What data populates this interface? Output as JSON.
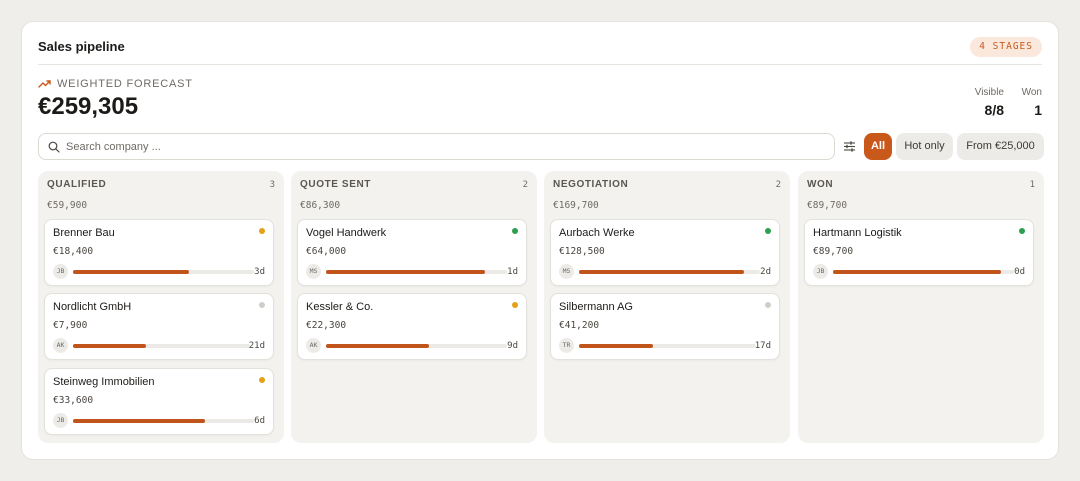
{
  "header": {
    "title": "Sales pipeline",
    "stages_badge": "4 STAGES"
  },
  "forecast": {
    "label": "WEIGHTED FORECAST",
    "value": "€259,305",
    "icon": "trend-up-icon"
  },
  "stats": {
    "visible_label": "Visible",
    "visible_value": "8/8",
    "won_label": "Won",
    "won_value": "1"
  },
  "search": {
    "placeholder": "Search company ...",
    "value": ""
  },
  "filters": [
    {
      "label": "All",
      "active": true
    },
    {
      "label": "Hot only",
      "active": false
    },
    {
      "label": "From €25,000",
      "active": false
    }
  ],
  "colors": {
    "accent": "#c9591b",
    "hot": "#e3a118",
    "active": "#2e9e4f",
    "idle": "#cfcdc8"
  },
  "columns": [
    {
      "name": "QUALIFIED",
      "count": "3",
      "total": "€59,900",
      "cards": [
        {
          "name": "Brenner Bau",
          "value": "€18,400",
          "owner": "JB",
          "progress": 0.64,
          "days": "3d",
          "status": "hot"
        },
        {
          "name": "Nordlicht GmbH",
          "value": "€7,900",
          "owner": "AK",
          "progress": 0.41,
          "days": "21d",
          "status": "idle"
        },
        {
          "name": "Steinweg Immobilien",
          "value": "€33,600",
          "owner": "JB",
          "progress": 0.73,
          "days": "6d",
          "status": "hot"
        }
      ]
    },
    {
      "name": "QUOTE SENT",
      "count": "2",
      "total": "€86,300",
      "cards": [
        {
          "name": "Vogel Handwerk",
          "value": "€64,000",
          "owner": "MS",
          "progress": 0.88,
          "days": "1d",
          "status": "active"
        },
        {
          "name": "Kessler & Co.",
          "value": "€22,300",
          "owner": "AK",
          "progress": 0.57,
          "days": "9d",
          "status": "hot"
        }
      ]
    },
    {
      "name": "NEGOTIATION",
      "count": "2",
      "total": "€169,700",
      "cards": [
        {
          "name": "Aurbach Werke",
          "value": "€128,500",
          "owner": "MS",
          "progress": 0.91,
          "days": "2d",
          "status": "active"
        },
        {
          "name": "Silbermann AG",
          "value": "€41,200",
          "owner": "TR",
          "progress": 0.42,
          "days": "17d",
          "status": "idle"
        }
      ]
    },
    {
      "name": "WON",
      "count": "1",
      "total": "€89,700",
      "cards": [
        {
          "name": "Hartmann Logistik",
          "value": "€89,700",
          "owner": "JB",
          "progress": 0.93,
          "days": "0d",
          "status": "active"
        }
      ]
    }
  ]
}
